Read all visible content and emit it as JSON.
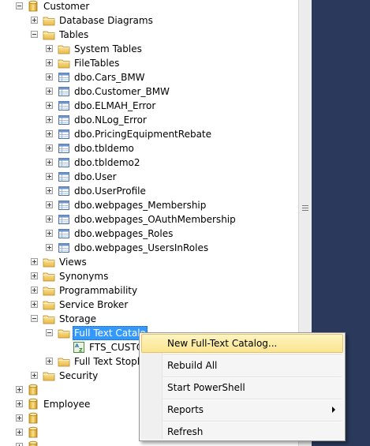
{
  "tree": {
    "customer": "Customer",
    "database_diagrams": "Database Diagrams",
    "tables": "Tables",
    "system_tables": "System Tables",
    "file_tables": "FileTables",
    "table_items": [
      "dbo.Cars_BMW",
      "dbo.Customer_BMW",
      "dbo.ELMAH_Error",
      "dbo.NLog_Error",
      "dbo.PricingEquipmentRebate",
      "dbo.tbldemo",
      "dbo.tbldemo2",
      "dbo.User",
      "dbo.UserProfile",
      "dbo.webpages_Membership",
      "dbo.webpages_OAuthMembership",
      "dbo.webpages_Roles",
      "dbo.webpages_UsersInRoles"
    ],
    "views": "Views",
    "synonyms": "Synonyms",
    "programmability": "Programmability",
    "service_broker": "Service Broker",
    "storage": "Storage",
    "full_text_catalogs": "Full Text Catalo",
    "fts_catalog": "FTS_CUSTO",
    "full_text_stoplists": "Full Text Stoplis",
    "security": "Security",
    "employee": "Employee"
  },
  "context_menu": {
    "items": [
      "New Full-Text Catalog...",
      "Rebuild All",
      "Start PowerShell",
      "Reports",
      "Refresh"
    ]
  },
  "colors": {
    "selection": "#3399ff",
    "menu_highlight": "#fbe58f",
    "folder": "#f2c94c",
    "right_pane": "#2b3a5c"
  }
}
